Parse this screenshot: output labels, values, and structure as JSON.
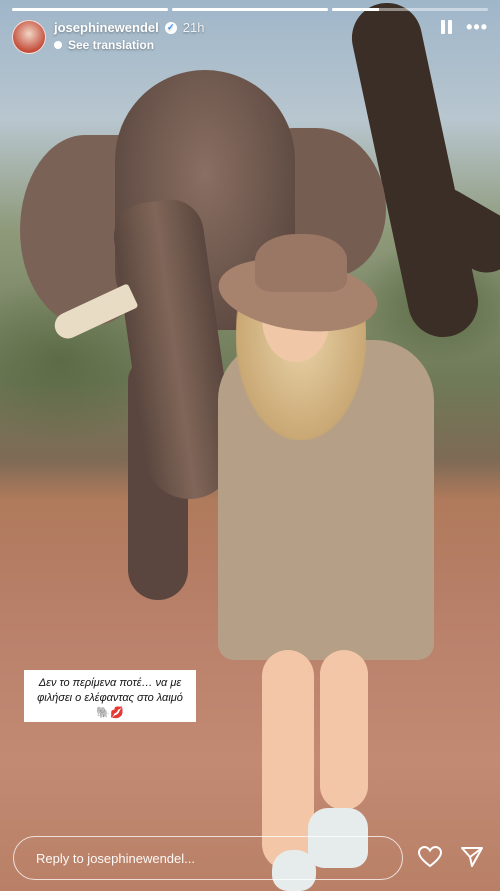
{
  "progress": {
    "segments": [
      1,
      1,
      0.3
    ]
  },
  "header": {
    "username": "josephinewendel",
    "verified": true,
    "time": "21h",
    "translate_label": "See translation",
    "icons": [
      "avatar",
      "verified-badge",
      "pause-icon",
      "more-icon"
    ]
  },
  "caption": {
    "line1": "Δεν το περίμενα ποτέ… να με",
    "line2": "φιλήσει ο ελέφαντας στο λαιμό",
    "emojis": "🐘💋"
  },
  "reply": {
    "placeholder": "Reply to josephinewendel..."
  },
  "actions": {
    "icons": [
      "heart-icon",
      "send-icon"
    ]
  },
  "colors": {
    "verified": "#3897f0",
    "overlay_text": "#ffffff"
  }
}
